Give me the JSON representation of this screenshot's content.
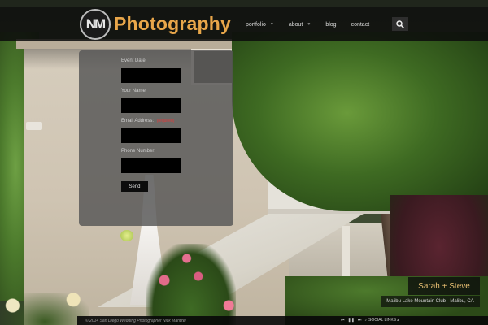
{
  "brand": {
    "monogram": "NM",
    "name": "Photography",
    "accent_color": "#e8a64a"
  },
  "nav": {
    "items": [
      {
        "label": "portfolio",
        "has_caret": true
      },
      {
        "label": "about",
        "has_caret": true
      },
      {
        "label": "blog",
        "has_caret": false
      },
      {
        "label": "contact",
        "has_caret": false
      }
    ],
    "search_icon": "search-icon"
  },
  "form": {
    "fields": [
      {
        "label": "Event Date:",
        "value": "",
        "required": false
      },
      {
        "label": "Your Name:",
        "value": "",
        "required": false
      },
      {
        "label": "Email Address:",
        "value": "",
        "required": true
      },
      {
        "label": "Phone Number:",
        "value": "",
        "required": false
      }
    ],
    "required_label": "(required)",
    "submit_label": "Send"
  },
  "caption": {
    "title": "Sarah + Steve",
    "subtitle": "Malibu Lake Mountain Club - Malibu, CA"
  },
  "footer": {
    "copyright": "© 2014 San Diego Wedding Photographer Nick Mantzel",
    "controls": [
      "prev-icon",
      "pause-icon",
      "next-icon",
      "volume-icon"
    ],
    "social_label": "SOCIAL LINKS"
  }
}
